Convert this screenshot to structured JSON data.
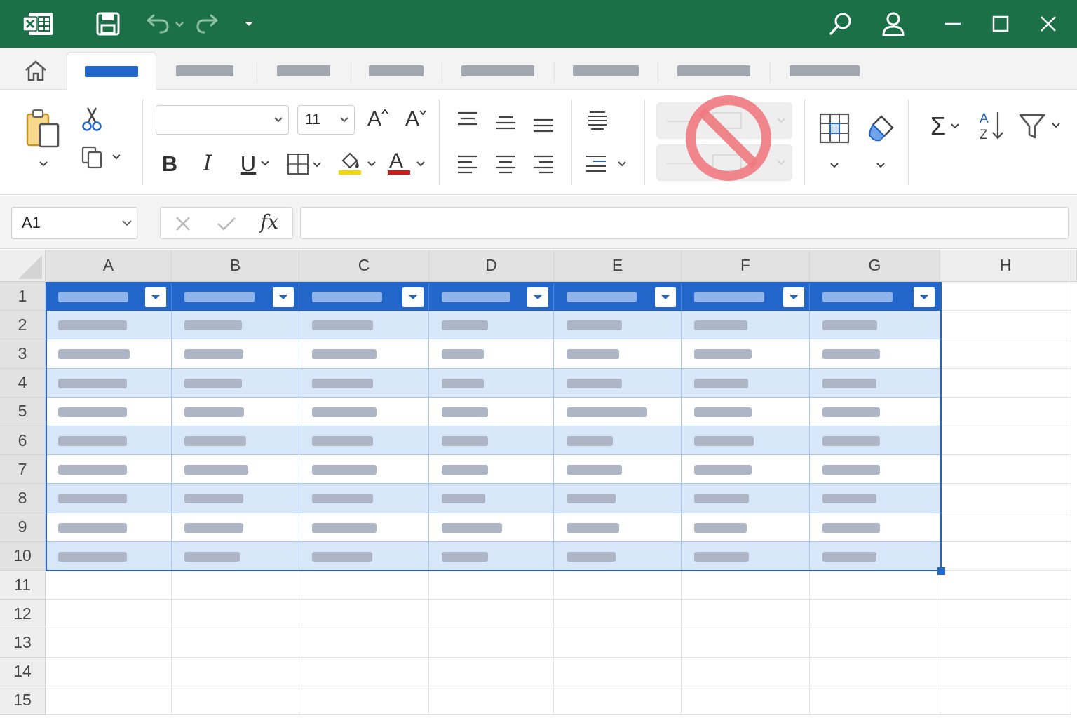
{
  "titlebar": {
    "icons": [
      "excel-logo-icon",
      "save-icon",
      "undo-icon",
      "redo-icon",
      "customize-qat-icon",
      "search-icon",
      "account-icon",
      "minimize-icon",
      "maximize-icon",
      "close-icon"
    ]
  },
  "tabs": {
    "icons": [
      "home-icon"
    ],
    "active_index": 0,
    "count": 8
  },
  "ribbon": {
    "font_name": "",
    "font_size": "11",
    "bold_label": "B",
    "italic_label": "I",
    "underline_label": "U",
    "font_color_label": "A",
    "grow_font_label": "A",
    "shrink_font_label": "A",
    "sum_label": "Σ",
    "sort_a": "A",
    "sort_z": "Z",
    "accent_colors": {
      "highlight": "#f5d800",
      "font_color": "#d11a1a"
    }
  },
  "formula_bar": {
    "name_box": "A1",
    "fx_label": "fx",
    "formula": ""
  },
  "grid": {
    "columns": [
      "A",
      "B",
      "C",
      "D",
      "E",
      "F",
      "G",
      "H"
    ],
    "rows": [
      "1",
      "2",
      "3",
      "4",
      "5",
      "6",
      "7",
      "8",
      "9",
      "10",
      "11",
      "12",
      "13",
      "14",
      "15"
    ],
    "table_accent": "#2366c9",
    "table_band": "#d9e7fb"
  }
}
